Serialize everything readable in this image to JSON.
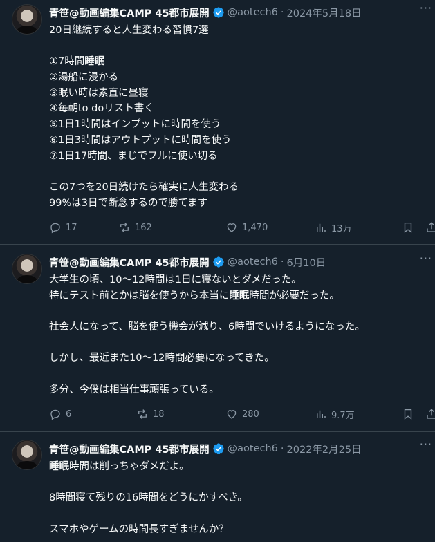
{
  "author": {
    "name": "青笹@動画編集CAMP 45都市展開",
    "handle": "@aotech6",
    "separator": "·"
  },
  "icons": {
    "verified": "verified-badge-icon",
    "more": "more-icon",
    "reply": "reply-icon",
    "retweet": "retweet-icon",
    "like": "like-icon",
    "views": "views-icon",
    "bookmark": "bookmark-icon",
    "share": "share-icon"
  },
  "colors": {
    "background": "#15202b",
    "text": "#f7f9f9",
    "muted": "#8b98a5",
    "verified": "#1d9bf0",
    "divider": "#38444d"
  },
  "more_label": "···",
  "tweets": [
    {
      "date": "2024年5月18日",
      "lines": [
        {
          "pre": "20日継続すると人生変わる習慣7選",
          "hl": "",
          "post": ""
        },
        {
          "pre": "",
          "hl": "",
          "post": ""
        },
        {
          "pre": "①7時間",
          "hl": "睡眠",
          "post": ""
        },
        {
          "pre": "②湯船に浸かる",
          "hl": "",
          "post": ""
        },
        {
          "pre": "③眠い時は素直に昼寝",
          "hl": "",
          "post": ""
        },
        {
          "pre": "④毎朝to doリスト書く",
          "hl": "",
          "post": ""
        },
        {
          "pre": "⑤1日1時間はインプットに時間を使う",
          "hl": "",
          "post": ""
        },
        {
          "pre": "⑥1日3時間はアウトプットに時間を使う",
          "hl": "",
          "post": ""
        },
        {
          "pre": "⑦1日17時間、まじでフルに使い切る",
          "hl": "",
          "post": ""
        },
        {
          "pre": "",
          "hl": "",
          "post": ""
        },
        {
          "pre": "この7つを20日続けたら確実に人生変わる",
          "hl": "",
          "post": ""
        },
        {
          "pre": "99%は3日で断念するので勝てます",
          "hl": "",
          "post": ""
        }
      ],
      "replies": "17",
      "retweets": "162",
      "likes": "1,470",
      "views": "13万"
    },
    {
      "date": "6月10日",
      "lines": [
        {
          "pre": "大学生の頃、10〜12時間は1日に寝ないとダメだった。",
          "hl": "",
          "post": ""
        },
        {
          "pre": "特にテスト前とかは脳を使うから本当に",
          "hl": "睡眠",
          "post": "時間が必要だった。"
        },
        {
          "pre": "",
          "hl": "",
          "post": ""
        },
        {
          "pre": "社会人になって、脳を使う機会が減り、6時間でいけるようになった。",
          "hl": "",
          "post": ""
        },
        {
          "pre": "",
          "hl": "",
          "post": ""
        },
        {
          "pre": "しかし、最近また10〜12時間必要になってきた。",
          "hl": "",
          "post": ""
        },
        {
          "pre": "",
          "hl": "",
          "post": ""
        },
        {
          "pre": "多分、今僕は相当仕事頑張っている。",
          "hl": "",
          "post": ""
        }
      ],
      "replies": "6",
      "retweets": "18",
      "likes": "280",
      "views": "9.7万"
    },
    {
      "date": "2022年2月25日",
      "lines": [
        {
          "pre": "",
          "hl": "睡眠",
          "post": "時間は削っちゃダメだよ。"
        },
        {
          "pre": "",
          "hl": "",
          "post": ""
        },
        {
          "pre": "8時間寝て残りの16時間をどうにかすべき。",
          "hl": "",
          "post": ""
        },
        {
          "pre": "",
          "hl": "",
          "post": ""
        },
        {
          "pre": "スマホやゲームの時間長すぎませんか？",
          "hl": "",
          "post": ""
        }
      ]
    }
  ]
}
